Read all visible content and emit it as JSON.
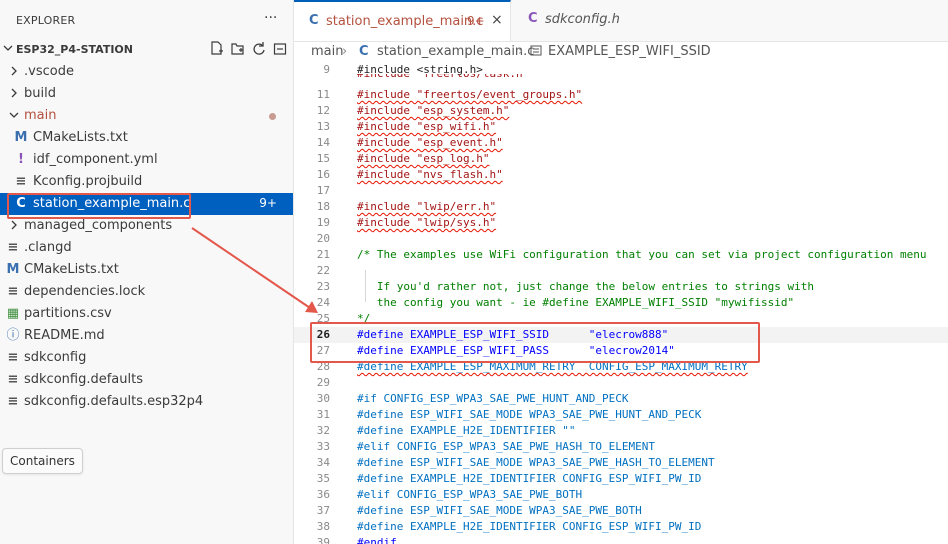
{
  "sidebar": {
    "title": "EXPLORER",
    "more": "···",
    "project": "ESP32_P4-STATION",
    "project_actions": [
      "new-file-icon",
      "new-folder-icon",
      "refresh-icon",
      "collapse-icon"
    ],
    "items": [
      {
        "label": ".vscode",
        "type": "folder",
        "expanded": false
      },
      {
        "label": "build",
        "type": "folder",
        "expanded": false
      },
      {
        "label": "main",
        "type": "folder",
        "expanded": true
      },
      {
        "label": "CMakeLists.txt",
        "icon": "M"
      },
      {
        "label": "idf_component.yml",
        "icon": "!"
      },
      {
        "label": "Kconfig.projbuild",
        "icon": "≡"
      },
      {
        "label": "station_example_main.c",
        "icon": "C",
        "badge": "9+"
      },
      {
        "label": "managed_components",
        "type": "folder",
        "expanded": false
      },
      {
        "label": ".clangd",
        "icon": "≡"
      },
      {
        "label": "CMakeLists.txt",
        "icon": "M"
      },
      {
        "label": "dependencies.lock",
        "icon": "≡"
      },
      {
        "label": "partitions.csv",
        "icon": "▦"
      },
      {
        "label": "README.md",
        "icon": "ⓘ"
      },
      {
        "label": "sdkconfig",
        "icon": "≡"
      },
      {
        "label": "sdkconfig.defaults",
        "icon": "≡"
      },
      {
        "label": "sdkconfig.defaults.esp32p4",
        "icon": "≡"
      }
    ],
    "containers": "Containers"
  },
  "tabs": [
    {
      "icon": "C",
      "label": "station_example_main.c",
      "count": "9+",
      "close": "×"
    },
    {
      "icon": "C",
      "label": "sdkconfig.h"
    }
  ],
  "breadcrumb": {
    "folder": "main",
    "file": "station_example_main.c",
    "symbol": "EXAMPLE_ESP_WIFI_SSID"
  },
  "editor": {
    "lines": [
      {
        "n": "9",
        "text": "#include <string.h>"
      },
      {
        "n": "",
        "text": "#include \"freertos/task.h\""
      },
      {
        "n": "11",
        "text": "#include \"freertos/event_groups.h\""
      },
      {
        "n": "12",
        "text": "#include \"esp_system.h\""
      },
      {
        "n": "13",
        "text": "#include \"esp_wifi.h\""
      },
      {
        "n": "14",
        "text": "#include \"esp_event.h\""
      },
      {
        "n": "15",
        "text": "#include \"esp_log.h\""
      },
      {
        "n": "16",
        "text": "#include \"nvs_flash.h\""
      },
      {
        "n": "17",
        "text": ""
      },
      {
        "n": "18",
        "text": "#include \"lwip/err.h\""
      },
      {
        "n": "19",
        "text": "#include \"lwip/sys.h\""
      },
      {
        "n": "20",
        "text": ""
      },
      {
        "n": "21",
        "text": "/* The examples use WiFi configuration that you can set via project configuration menu"
      },
      {
        "n": "22",
        "text": ""
      },
      {
        "n": "23",
        "text": "   If you'd rather not, just change the below entries to strings with"
      },
      {
        "n": "24",
        "text": "   the config you want - ie #define EXAMPLE_WIFI_SSID \"mywifissid\""
      },
      {
        "n": "25",
        "text": "*/"
      },
      {
        "n": "26",
        "text": "#define EXAMPLE_ESP_WIFI_SSID      \"elecrow888\""
      },
      {
        "n": "27",
        "text": "#define EXAMPLE_ESP_WIFI_PASS      \"elecrow2014\""
      },
      {
        "n": "28",
        "text": "#define EXAMPLE_ESP_MAXIMUM_RETRY  CONFIG_ESP_MAXIMUM_RETRY"
      },
      {
        "n": "29",
        "text": ""
      },
      {
        "n": "30",
        "text": "#if CONFIG_ESP_WPA3_SAE_PWE_HUNT_AND_PECK"
      },
      {
        "n": "31",
        "text": "#define ESP_WIFI_SAE_MODE WPA3_SAE_PWE_HUNT_AND_PECK"
      },
      {
        "n": "32",
        "text": "#define EXAMPLE_H2E_IDENTIFIER \"\""
      },
      {
        "n": "33",
        "text": "#elif CONFIG_ESP_WPA3_SAE_PWE_HASH_TO_ELEMENT"
      },
      {
        "n": "34",
        "text": "#define ESP_WIFI_SAE_MODE WPA3_SAE_PWE_HASH_TO_ELEMENT"
      },
      {
        "n": "35",
        "text": "#define EXAMPLE_H2E_IDENTIFIER CONFIG_ESP_WIFI_PW_ID"
      },
      {
        "n": "36",
        "text": "#elif CONFIG_ESP_WPA3_SAE_PWE_BOTH"
      },
      {
        "n": "37",
        "text": "#define ESP_WIFI_SAE_MODE WPA3_SAE_PWE_BOTH"
      },
      {
        "n": "38",
        "text": "#define EXAMPLE_H2E_IDENTIFIER CONFIG_ESP_WIFI_PW_ID"
      },
      {
        "n": "39",
        "text": "#endif"
      }
    ]
  },
  "colors": {
    "accent": "#005fb8",
    "selection": "#0060c0",
    "annotation": "#e4574b"
  }
}
